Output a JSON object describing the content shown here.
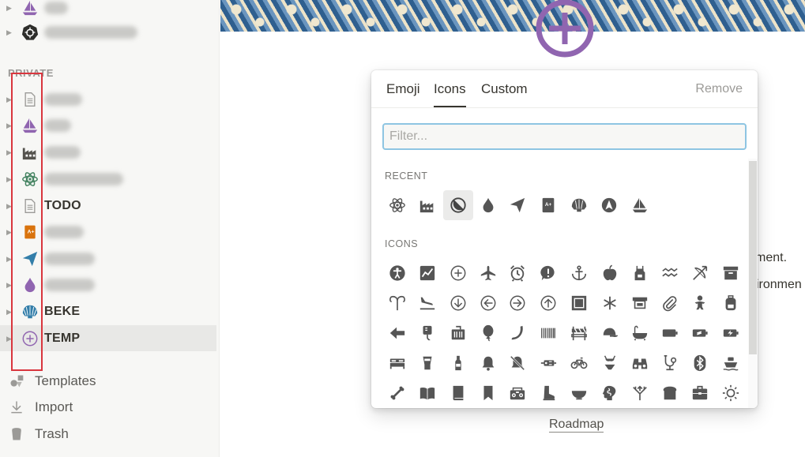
{
  "sidebar": {
    "section_private": "PRIVATE",
    "pages": [
      {
        "label": "",
        "icon": "sailboat-icon",
        "color": "#9065b0"
      },
      {
        "label": "",
        "icon": "kubernetes-icon",
        "color": "#37352f"
      },
      {
        "label": "",
        "icon": "document-icon",
        "color": "#9b9a97"
      },
      {
        "label": "",
        "icon": "sailboat-icon",
        "color": "#9065b0"
      },
      {
        "label": "",
        "icon": "factory-icon",
        "color": "#55534e"
      },
      {
        "label": "",
        "icon": "atom-icon",
        "color": "#448361"
      },
      {
        "label": "TODO",
        "icon": "document-icon",
        "color": "#9b9a97"
      },
      {
        "label": "",
        "icon": "grade-book-icon",
        "color": "#d9730d"
      },
      {
        "label": "",
        "icon": "paper-plane-icon",
        "color": "#337ea9"
      },
      {
        "label": "",
        "icon": "drop-icon",
        "color": "#9065b0"
      },
      {
        "label": "BEKE",
        "icon": "shell-icon",
        "color": "#337ea9"
      },
      {
        "label": "TEMP",
        "icon": "add-circle-icon",
        "color": "#9065b0"
      }
    ],
    "bottom": {
      "templates": "Templates",
      "import": "Import",
      "trash": "Trash"
    }
  },
  "main": {
    "behind_text_1": "ment.",
    "behind_text_2": "ironmen",
    "roadmap_link": "Roadmap",
    "page_icon_color": "#9065b0"
  },
  "icon_picker": {
    "tabs": [
      "Emoji",
      "Icons",
      "Custom"
    ],
    "active_tab": "Icons",
    "remove_label": "Remove",
    "filter_placeholder": "Filter...",
    "filter_value": "",
    "recent_title": "RECENT",
    "recent": [
      "atom-icon",
      "factory-icon",
      "block-icon",
      "drop-icon",
      "paper-plane-icon",
      "grade-book-icon",
      "shell-icon",
      "compass-icon",
      "sailboat-icon"
    ],
    "recent_selected": "block-icon",
    "icons_title": "ICONS",
    "icons_rows": [
      [
        "accessibility-icon",
        "activity-chart-icon",
        "add-circle-icon",
        "airplane-icon",
        "alarm-clock-icon",
        "alert-bubble-icon",
        "anchor-icon",
        "apple-icon",
        "apron-icon",
        "aquarius-icon",
        "archery-icon",
        "archive-icon"
      ],
      [
        "aries-icon",
        "arrival-icon",
        "arrow-down-circle-icon",
        "arrow-left-circle-icon",
        "arrow-right-circle-icon",
        "arrow-up-circle-icon",
        "artwork-icon",
        "asterisk-icon",
        "atm-icon",
        "attachment-icon",
        "baby-icon",
        "backpack-icon"
      ],
      [
        "backward-icon",
        "bag-drip-icon",
        "baggage-icon",
        "balloon-icon",
        "banana-icon",
        "barcode-icon",
        "barrier-icon",
        "baseball-cap-icon",
        "bath-icon",
        "battery-icon",
        "battery-charging-icon",
        "battery-bolt-icon"
      ],
      [
        "bed-icon",
        "beer-icon",
        "bottle-icon",
        "bell-icon",
        "bell-off-icon",
        "bicycle-lock-icon",
        "bicycle-icon",
        "bikini-icon",
        "binoculars-icon",
        "biology-icon",
        "bluetooth-icon",
        "boat-icon"
      ],
      [
        "bone-icon",
        "book-open-icon",
        "book-icon",
        "bookmark-icon",
        "boombox-icon",
        "boot-icon",
        "bowl-icon",
        "brain-icon",
        "branch-icon",
        "bread-icon",
        "briefcase-icon",
        "brightness-icon"
      ]
    ],
    "scrollbar_position": 0.05
  }
}
